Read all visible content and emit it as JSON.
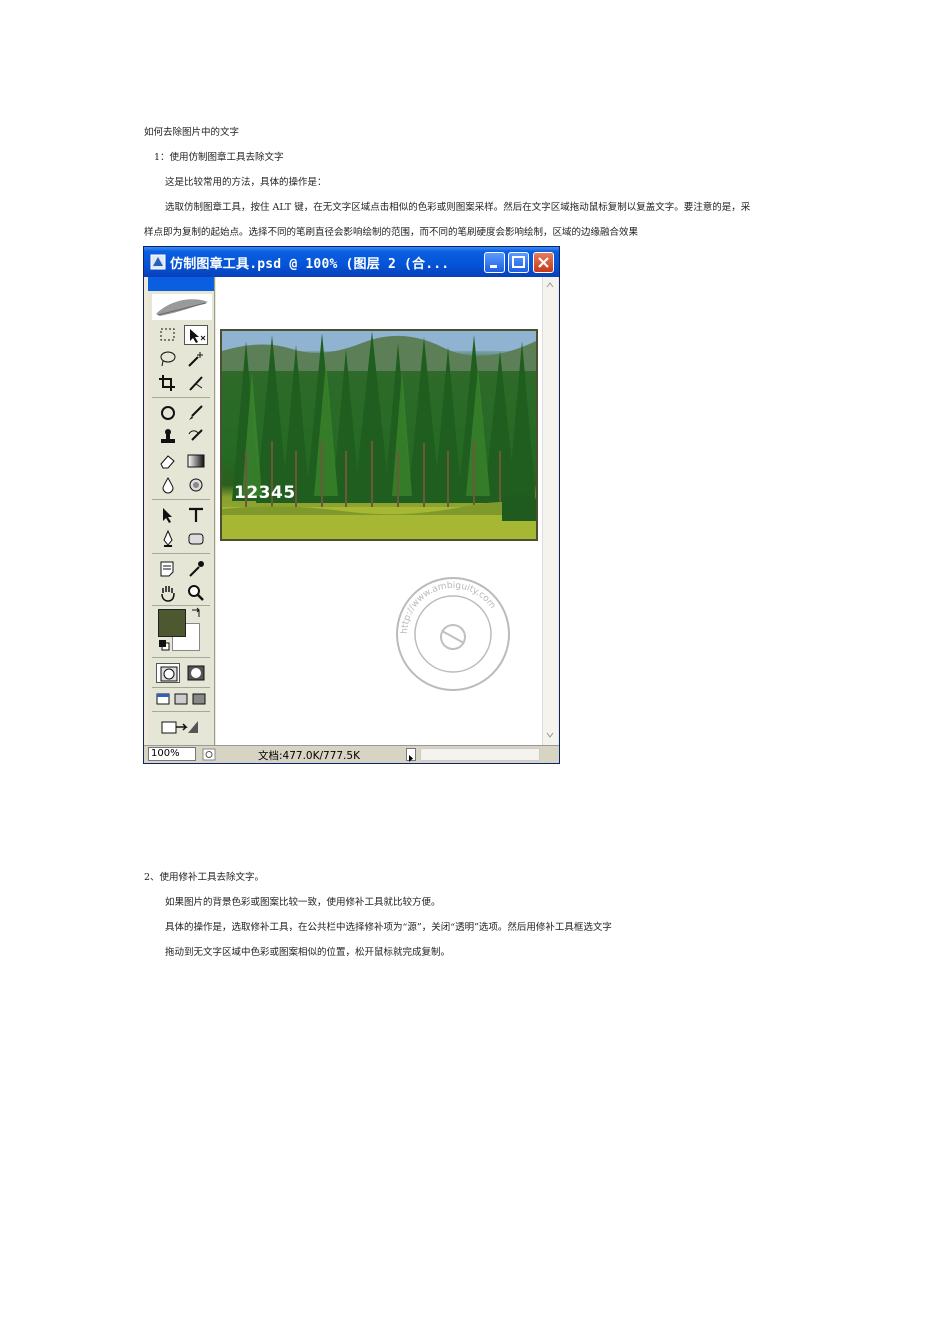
{
  "doc": {
    "heading": "如何去除图片中的文字",
    "section1": {
      "title": "1：使用仿制图章工具去除文字",
      "intro": "这是比较常用的方法，具体的操作是：",
      "step_line1": "选取仿制图章工具，按住 ALT 键，在无文字区域点击相似的色彩或则图案采样。然后在文字区域拖动鼠标复制以复盖文字。要注意的是，采",
      "step_line2": "样点即为复制的起始点。选择不同的笔刷直径会影响绘制的范围，而不同的笔刷硬度会影响绘制，区域的边缘融合效果"
    },
    "section2": {
      "title": "2、使用修补工具去除文字。",
      "line1": "如果图片的背景色彩或图案比较一致，使用修补工具就比较方便。",
      "line2": "具体的操作是，选取修补工具，在公共栏中选择修补项为“源”，关闭“透明”选项。然后用修补工具框选文字",
      "line3": "拖动到无文字区域中色彩或图案相似的位置，松开鼠标就完成复制。"
    }
  },
  "screenshot": {
    "window_title": "仿制图章工具.psd @ 100% (图层 2 (合...",
    "photo_text": "12345",
    "zoom": "100%",
    "doc_size": "文档:477.0K/777.5K",
    "stamp_text": "http://www.ambiguity.com",
    "colors": {
      "title_blue": "#0553d6",
      "foreground": "#4d5830",
      "background": "#ffffff"
    }
  }
}
